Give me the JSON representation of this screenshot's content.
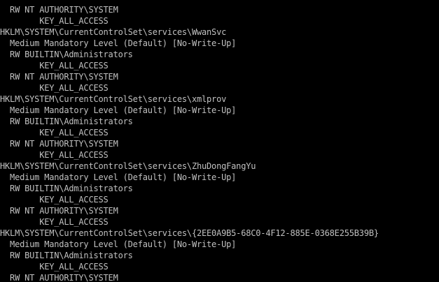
{
  "console": {
    "text_color": "#c0c0c0",
    "background_color": "#000000",
    "lines": [
      "  RW NT AUTHORITY\\SYSTEM",
      "        KEY_ALL_ACCESS",
      "HKLM\\SYSTEM\\CurrentControlSet\\services\\WwanSvc",
      "  Medium Mandatory Level (Default) [No-Write-Up]",
      "  RW BUILTIN\\Administrators",
      "        KEY_ALL_ACCESS",
      "  RW NT AUTHORITY\\SYSTEM",
      "        KEY_ALL_ACCESS",
      "HKLM\\SYSTEM\\CurrentControlSet\\services\\xmlprov",
      "  Medium Mandatory Level (Default) [No-Write-Up]",
      "  RW BUILTIN\\Administrators",
      "        KEY_ALL_ACCESS",
      "  RW NT AUTHORITY\\SYSTEM",
      "        KEY_ALL_ACCESS",
      "HKLM\\SYSTEM\\CurrentControlSet\\services\\ZhuDongFangYu",
      "  Medium Mandatory Level (Default) [No-Write-Up]",
      "  RW BUILTIN\\Administrators",
      "        KEY_ALL_ACCESS",
      "  RW NT AUTHORITY\\SYSTEM",
      "        KEY_ALL_ACCESS",
      "HKLM\\SYSTEM\\CurrentControlSet\\services\\{2EE0A9B5-68C0-4F12-885E-0368E255B39B}",
      "  Medium Mandatory Level (Default) [No-Write-Up]",
      "  RW BUILTIN\\Administrators",
      "        KEY_ALL_ACCESS",
      "  RW NT AUTHORITY\\SYSTEM"
    ]
  }
}
